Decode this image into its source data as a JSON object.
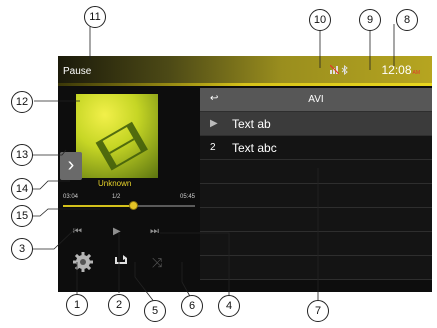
{
  "status_bar": {
    "status_text": "Pause",
    "time": "12:08",
    "ampm": "AM"
  },
  "player": {
    "album_name": "Unknown",
    "elapsed": "03:04",
    "track_position": "1/2",
    "total": "05:45",
    "progress": 0.53
  },
  "list": {
    "header": {
      "back_icon": "back-arrow-icon",
      "title": "AVI"
    },
    "rows": [
      {
        "lead": "▶",
        "label": "Text ab"
      },
      {
        "lead": "2",
        "label": "Text abc"
      },
      {
        "lead": "",
        "label": ""
      },
      {
        "lead": "",
        "label": ""
      },
      {
        "lead": "",
        "label": ""
      },
      {
        "lead": "",
        "label": ""
      },
      {
        "lead": "",
        "label": ""
      }
    ]
  },
  "callouts": [
    "1",
    "2",
    "3",
    "4",
    "5",
    "6",
    "7",
    "8",
    "9",
    "10",
    "11",
    "12",
    "13",
    "14",
    "15"
  ],
  "colors": {
    "accent": "#d4c11b",
    "album_text": "#e8d32a",
    "ampm": "#e13a2a"
  }
}
